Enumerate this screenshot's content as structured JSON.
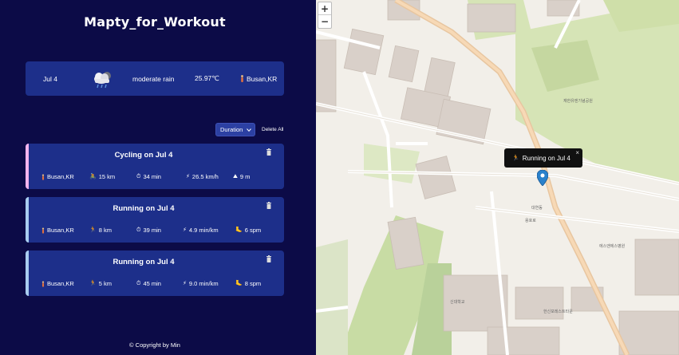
{
  "app": {
    "title": "Mapty_for_Workout"
  },
  "weather": {
    "date": "Jul 4",
    "icon": "rain-cloud-icon",
    "description": "moderate rain",
    "temperature": "25.97℃",
    "location": "Busan,KR"
  },
  "controls": {
    "sort_value": "Duration",
    "delete_all_label": "Delete All"
  },
  "workouts": [
    {
      "type": "cycling",
      "title": "Cycling on Jul 4",
      "location": "Busan,KR",
      "distance": "15 km",
      "duration": "34 min",
      "speed": "26.5 km/h",
      "elevation": "9 m"
    },
    {
      "type": "running",
      "title": "Running on Jul 4",
      "location": "Busan,KR",
      "distance": "8 km",
      "duration": "39 min",
      "pace": "4.9 min/km",
      "cadence": "6 spm"
    },
    {
      "type": "running",
      "title": "Running on Jul 4",
      "location": "Busan,KR",
      "distance": "5 km",
      "duration": "45 min",
      "pace": "9.0 min/km",
      "cadence": "8 spm"
    }
  ],
  "footer": {
    "text": "© Copyright by Min"
  },
  "map": {
    "zoom_in": "+",
    "zoom_out": "−",
    "popup_text": "Running on Jul 4",
    "popup_close": "×",
    "marker_color": "#2a81cb",
    "labels": {
      "memorial": "재한유엔기념공원",
      "daeyeon": "대연동",
      "yongho": "용호로",
      "hospital": "에스앤에스병원",
      "school": "신대학교",
      "apartment": "한신포레스트타운"
    }
  },
  "colors": {
    "sidebar_bg": "#0c0b47",
    "card_bg": "#1d2f8a",
    "cycling_accent": "#f4b4ee",
    "running_accent": "#a9cdf0"
  }
}
